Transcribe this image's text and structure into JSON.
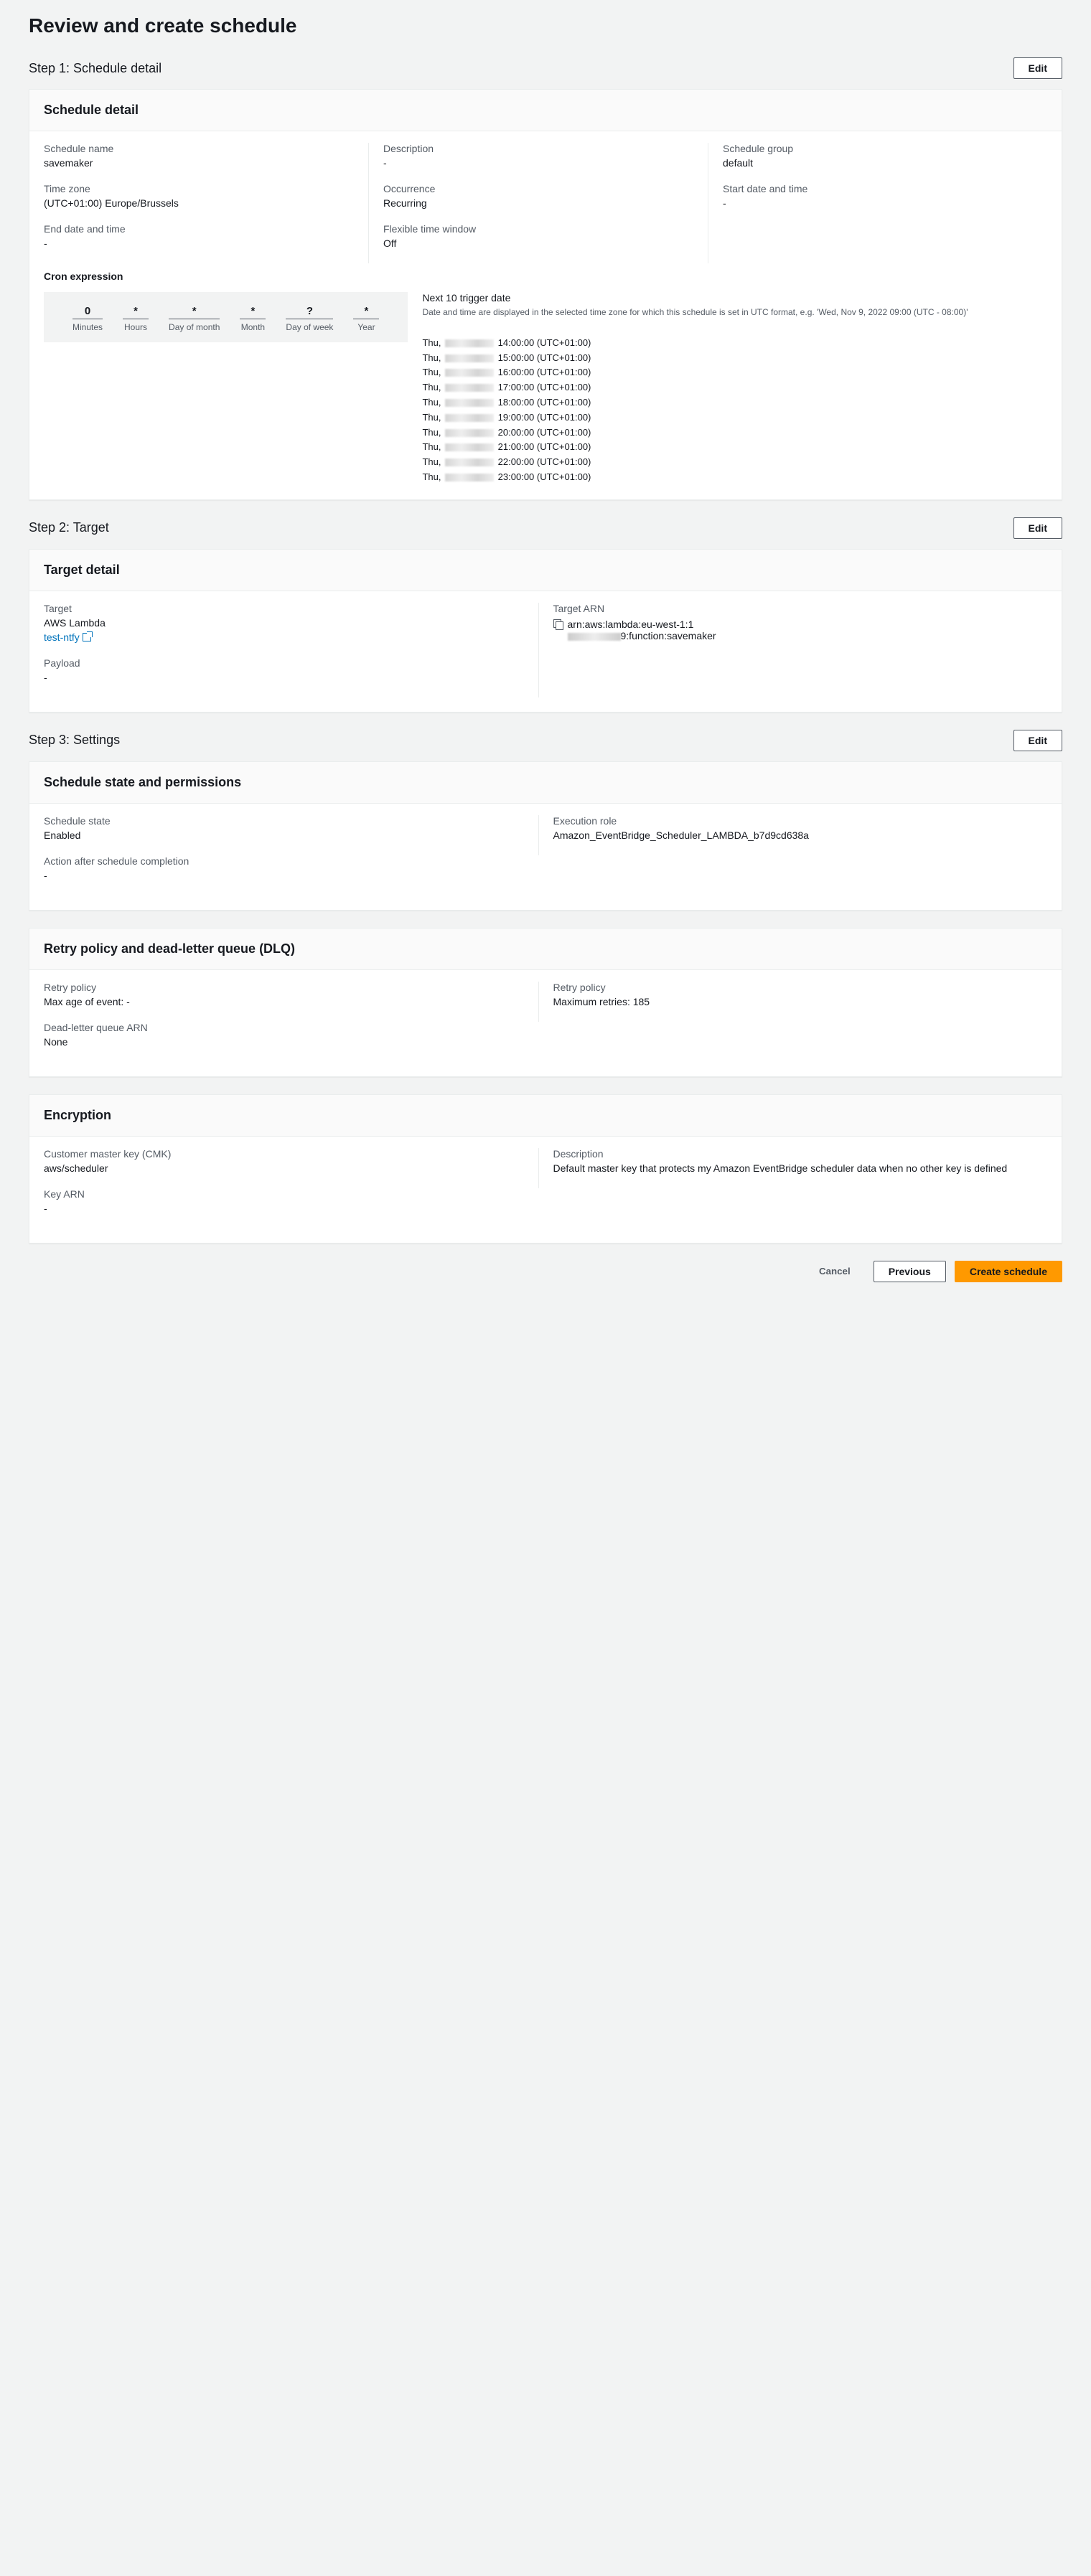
{
  "page_title": "Review and create schedule",
  "edit_label": "Edit",
  "steps": {
    "s1": {
      "title": "Step 1: Schedule detail"
    },
    "s2": {
      "title": "Step 2: Target"
    },
    "s3": {
      "title": "Step 3: Settings"
    }
  },
  "schedule_detail": {
    "panel_title": "Schedule detail",
    "name_label": "Schedule name",
    "name_value": "savemaker",
    "desc_label": "Description",
    "desc_value": "-",
    "group_label": "Schedule group",
    "group_value": "default",
    "tz_label": "Time zone",
    "tz_value": "(UTC+01:00) Europe/Brussels",
    "occ_label": "Occurrence",
    "occ_value": "Recurring",
    "start_label": "Start date and time",
    "start_value": "-",
    "end_label": "End date and time",
    "end_value": "-",
    "flex_label": "Flexible time window",
    "flex_value": "Off",
    "cron_label": "Cron expression",
    "cron": {
      "minutes": {
        "v": "0",
        "l": "Minutes"
      },
      "hours": {
        "v": "*",
        "l": "Hours"
      },
      "dom": {
        "v": "*",
        "l": "Day of month"
      },
      "month": {
        "v": "*",
        "l": "Month"
      },
      "dow": {
        "v": "?",
        "l": "Day of week"
      },
      "year": {
        "v": "*",
        "l": "Year"
      }
    },
    "triggers": {
      "title": "Next 10 trigger date",
      "hint": "Date and time are displayed in the selected time zone for which this schedule is set in UTC format, e.g. 'Wed, Nov 9, 2022 09:00 (UTC - 08:00)'",
      "items": [
        {
          "day": "Thu,",
          "time": "14:00:00 (UTC+01:00)"
        },
        {
          "day": "Thu,",
          "time": "15:00:00 (UTC+01:00)"
        },
        {
          "day": "Thu,",
          "time": "16:00:00 (UTC+01:00)"
        },
        {
          "day": "Thu,",
          "time": "17:00:00 (UTC+01:00)"
        },
        {
          "day": "Thu,",
          "time": "18:00:00 (UTC+01:00)"
        },
        {
          "day": "Thu,",
          "time": "19:00:00 (UTC+01:00)"
        },
        {
          "day": "Thu,",
          "time": "20:00:00 (UTC+01:00)"
        },
        {
          "day": "Thu,",
          "time": "21:00:00 (UTC+01:00)"
        },
        {
          "day": "Thu,",
          "time": "22:00:00 (UTC+01:00)"
        },
        {
          "day": "Thu,",
          "time": "23:00:00 (UTC+01:00)"
        }
      ]
    }
  },
  "target": {
    "panel_title": "Target detail",
    "target_label": "Target",
    "target_value": "AWS Lambda",
    "target_link": "test-ntfy",
    "payload_label": "Payload",
    "payload_value": "-",
    "arn_label": "Target ARN",
    "arn_prefix": "arn:aws:lambda:eu-west-1:1",
    "arn_suffix": "9:function:savemaker"
  },
  "state": {
    "panel_title": "Schedule state and permissions",
    "state_label": "Schedule state",
    "state_value": "Enabled",
    "role_label": "Execution role",
    "role_value": "Amazon_EventBridge_Scheduler_LAMBDA_b7d9cd638a",
    "action_label": "Action after schedule completion",
    "action_value": "-"
  },
  "retry": {
    "panel_title": "Retry policy and dead-letter queue (DLQ)",
    "p1_label": "Retry policy",
    "p1_value": "Max age of event: -",
    "p2_label": "Retry policy",
    "p2_value": "Maximum retries: 185",
    "dlq_label": "Dead-letter queue ARN",
    "dlq_value": "None"
  },
  "encryption": {
    "panel_title": "Encryption",
    "cmk_label": "Customer master key (CMK)",
    "cmk_value": "aws/scheduler",
    "desc_label": "Description",
    "desc_value": "Default master key that protects my Amazon EventBridge scheduler data when no other key is defined",
    "arn_label": "Key ARN",
    "arn_value": "-"
  },
  "footer": {
    "cancel": "Cancel",
    "previous": "Previous",
    "create": "Create schedule"
  }
}
